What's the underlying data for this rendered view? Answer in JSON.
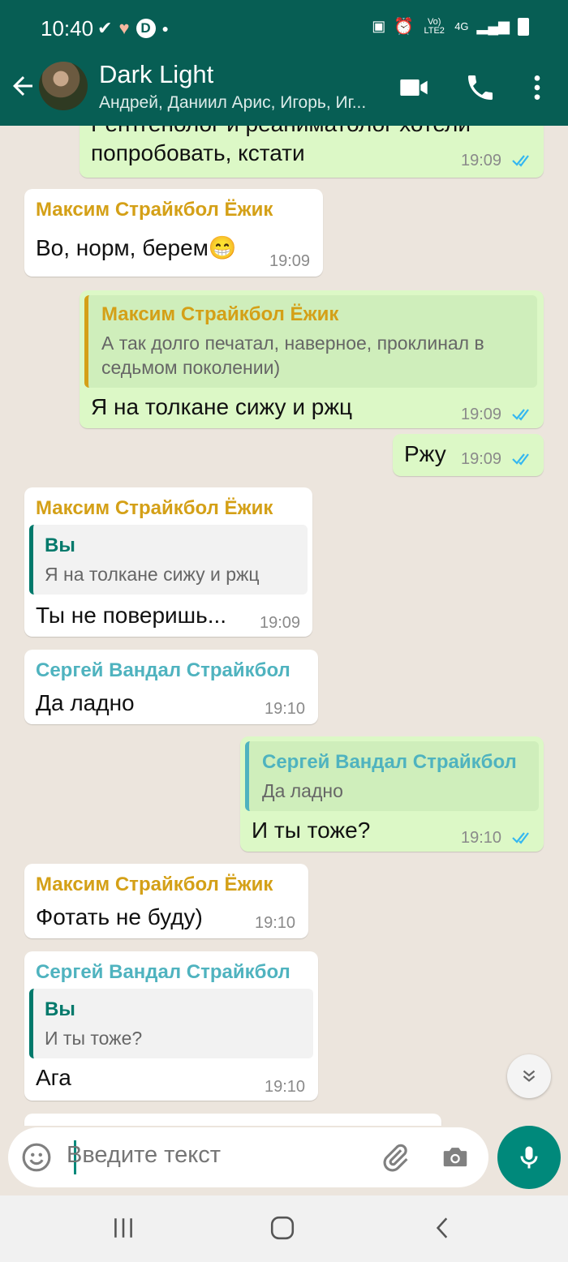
{
  "status_bar": {
    "time": "10:40",
    "network": "4G",
    "lte": "Vo) LTE2"
  },
  "header": {
    "title": "Dark Light",
    "subtitle": "Андрей, Даниил Арис, Игорь, Иг..."
  },
  "messages": [
    {
      "type": "out",
      "text_line1": "Рентгенолог и реаниматолог хотели",
      "text_line2": "попробовать, кстати",
      "time": "19:09"
    },
    {
      "type": "in",
      "sender": "Максим Страйкбол Ёжик",
      "text": "Во, норм, берем😁",
      "time": "19:09"
    },
    {
      "type": "out",
      "quote_name": "Максим Страйкбол Ёжик",
      "quote_text": "А так долго печатал, наверное, проклинал в седьмом поколении)",
      "text": "Я на толкане сижу и ржц",
      "time": "19:09"
    },
    {
      "type": "out",
      "text": "Ржу",
      "time": "19:09"
    },
    {
      "type": "in",
      "sender": "Максим Страйкбол Ёжик",
      "quote_name": "Вы",
      "quote_text": "Я на толкане сижу и ржц",
      "text": "Ты не поверишь...",
      "time": "19:09"
    },
    {
      "type": "in",
      "sender": "Сергей Вандал Страйкбол",
      "text": "Да ладно",
      "time": "19:10"
    },
    {
      "type": "out",
      "quote_name": "Сергей Вандал Страйкбол",
      "quote_text": "Да ладно",
      "text": "И ты тоже?",
      "time": "19:10"
    },
    {
      "type": "in",
      "sender": "Максим Страйкбол Ёжик",
      "text": "Фотать не буду)",
      "time": "19:10"
    },
    {
      "type": "in",
      "sender": "Сергей Вандал Страйкбол",
      "quote_name": "Вы",
      "quote_text": "И ты тоже?",
      "text": "Ага",
      "time": "19:10"
    }
  ],
  "input": {
    "placeholder": "Введите текст"
  },
  "colors": {
    "header": "#075e54",
    "accent": "#00897b",
    "sender_maxim": "#d4a017",
    "sender_sergey": "#4fb3bf",
    "you_quote": "#00796b",
    "read_ticks": "#34b7f1",
    "bubble_out": "#dcf8c6"
  }
}
